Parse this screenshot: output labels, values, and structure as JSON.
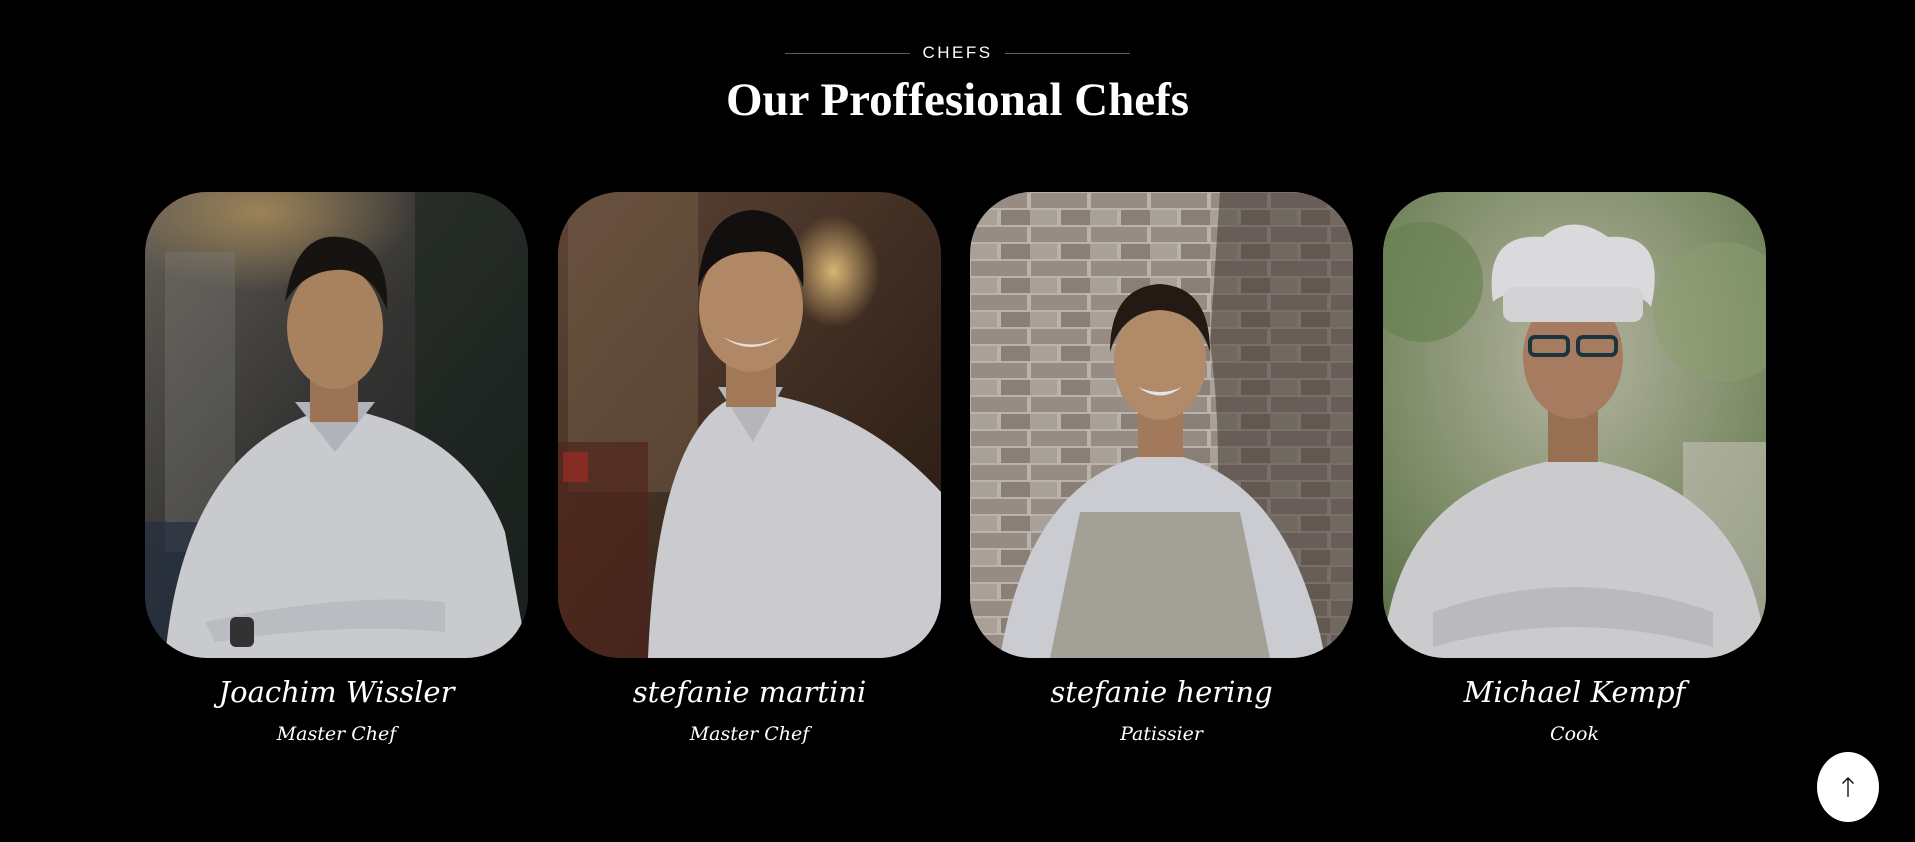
{
  "section": {
    "eyebrow": "CHEFS",
    "title": "Our Proffesional Chefs"
  },
  "chefs": [
    {
      "name": "Joachim Wissler",
      "role": "Master Chef"
    },
    {
      "name": "stefanie martini",
      "role": "Master Chef"
    },
    {
      "name": "stefanie hering",
      "role": "Patissier"
    },
    {
      "name": "Michael Kempf",
      "role": "Cook"
    }
  ],
  "scroll_top": {
    "icon": "arrow-up-icon"
  },
  "colors": {
    "background": "#000000",
    "text": "#ffffff",
    "divider": "#5c5c5c",
    "button": "#ffffff"
  }
}
